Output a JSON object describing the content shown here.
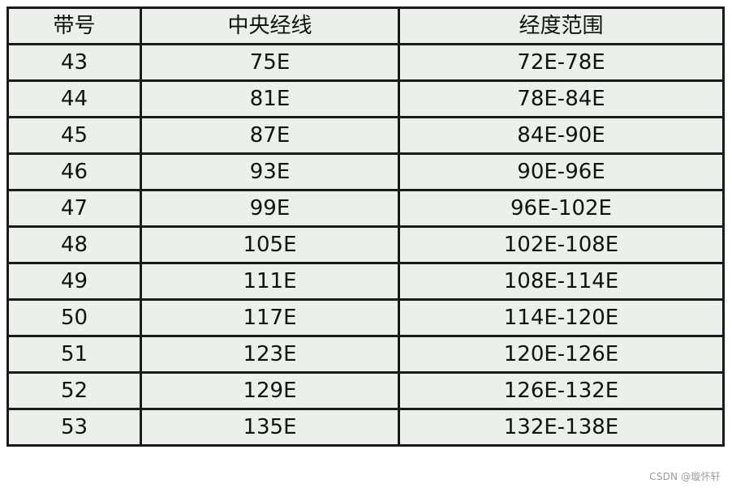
{
  "table": {
    "headers": [
      "带号",
      "中央经线",
      "经度范围"
    ],
    "rows": [
      [
        "43",
        "75E",
        "72E-78E"
      ],
      [
        "44",
        "81E",
        "78E-84E"
      ],
      [
        "45",
        "87E",
        "84E-90E"
      ],
      [
        "46",
        "93E",
        "90E-96E"
      ],
      [
        "47",
        "99E",
        "96E-102E"
      ],
      [
        "48",
        "105E",
        "102E-108E"
      ],
      [
        "49",
        "111E",
        "108E-114E"
      ],
      [
        "50",
        "117E",
        "114E-120E"
      ],
      [
        "51",
        "123E",
        "120E-126E"
      ],
      [
        "52",
        "129E",
        "126E-132E"
      ],
      [
        "53",
        "135E",
        "132E-138E"
      ]
    ]
  },
  "watermark": "CSDN @璇怀轩",
  "colors": {
    "cell_background": "#eaf1ea",
    "border": "#1a1a1a"
  }
}
